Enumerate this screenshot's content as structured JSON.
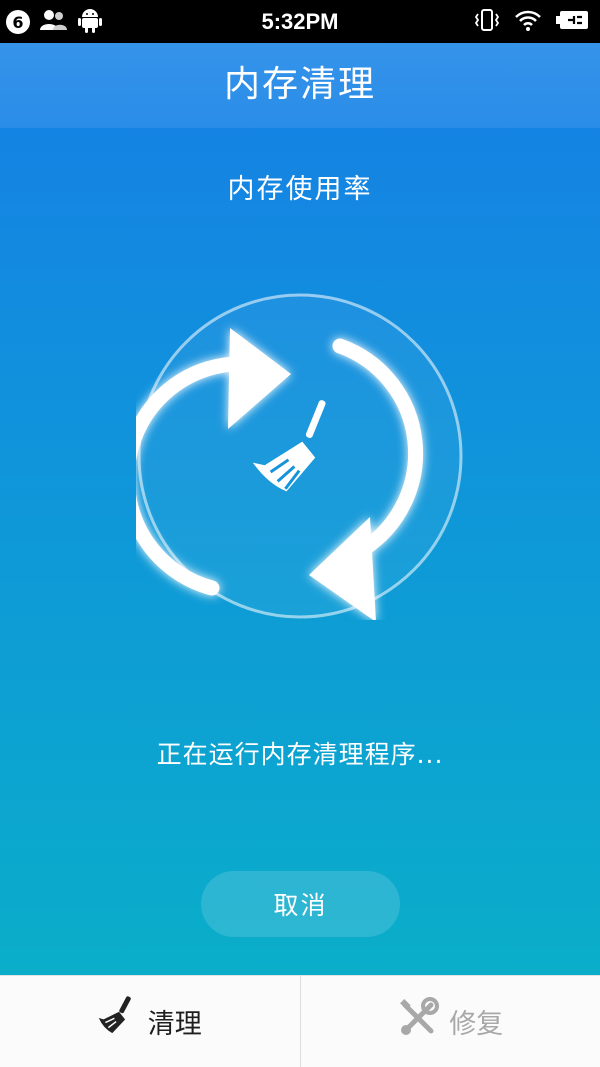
{
  "status_bar": {
    "notification_count": "6",
    "time": "5:32PM"
  },
  "header": {
    "title": "内存清理"
  },
  "main": {
    "subtitle": "内存使用率",
    "status_text": "正在运行内存清理程序...",
    "cancel_label": "取消",
    "center_icon": "broom-icon",
    "ring_icon": "refresh-arrows-icon"
  },
  "bottom_nav": {
    "items": [
      {
        "label": "清理",
        "icon": "broom-icon",
        "active": true
      },
      {
        "label": "修复",
        "icon": "tools-icon",
        "active": false
      }
    ]
  },
  "colors": {
    "gradient_top": "#167fe6",
    "gradient_bottom": "#0aaec9",
    "title_bar": "#2a8de8",
    "nav_active": "#1e1e1e",
    "nav_inactive": "#a8a8a8"
  }
}
